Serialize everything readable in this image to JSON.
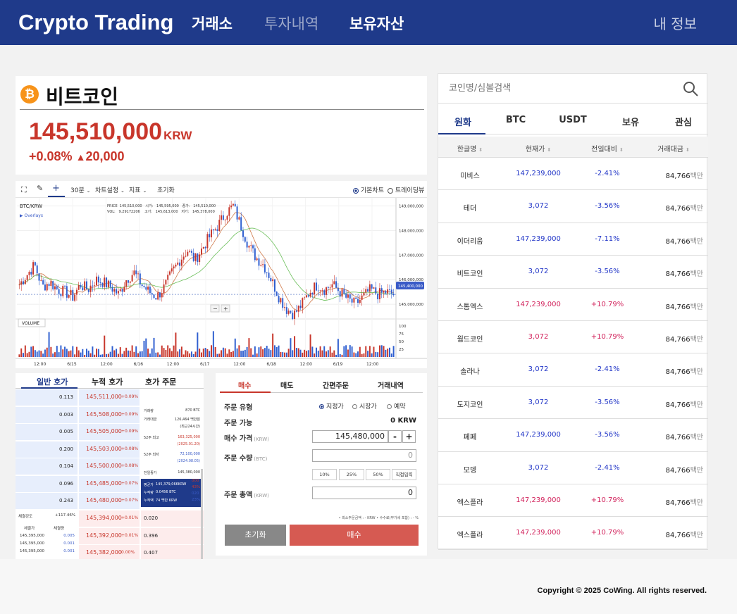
{
  "header": {
    "brand": "Crypto Trading",
    "nav": [
      "거래소",
      "투자내역",
      "보유자산"
    ],
    "my_info": "내 정보"
  },
  "coin": {
    "logo_symbol": "₿",
    "name": "비트코인",
    "price": "145,510,000",
    "unit": "KRW",
    "change_pct": "+0.08%",
    "change_arrow": "▲",
    "change_amount": "20,000"
  },
  "chart": {
    "toolbar": {
      "interval": "30분",
      "chart_settings": "차트설정",
      "indicators": "지표",
      "reset": "초기화",
      "basic_chart": "기본차트",
      "tradingview": "트레이딩뷰"
    },
    "symbol": "BTC/KRW",
    "overlays": "Overlays",
    "ohlc_line1": "PRICE  145,510,000   시가:   145,595,000   종가:   145,510,000",
    "ohlc_line2": "VOL:   9.29172206    고가:   145,613,000   저가:   145,378,000",
    "volume_label": "VOLUME",
    "current_price_tag": "145,400,000",
    "zoom_minus": "−",
    "zoom_plus": "+"
  },
  "chart_data": {
    "type": "candlestick",
    "price_axis": [
      "149,000,000",
      "148,000,000",
      "147,000,000",
      "146,000,000",
      "145,000,000"
    ],
    "volume_axis": [
      "100",
      "75",
      "50",
      "25"
    ],
    "x_labels": [
      "12:00",
      "6/15",
      "12:00",
      "6/16",
      "12:00",
      "6/17",
      "12:00",
      "6/18",
      "12:00",
      "6/19",
      "12:00"
    ],
    "ylim": [
      144400000,
      149100000
    ],
    "close_series": [
      145800000,
      146200000,
      146600000,
      145700000,
      145900000,
      145600000,
      145500000,
      145300000,
      145800000,
      145600000,
      146000000,
      145900000,
      145700000,
      145400000,
      146000000,
      146300000,
      145800000,
      145500000,
      145300000,
      145700000,
      146300000,
      146800000,
      147200000,
      146800000,
      147300000,
      147800000,
      148200000,
      148700000,
      149000000,
      148200000,
      147400000,
      146900000,
      146600000,
      146000000,
      145300000,
      144800000,
      144600000,
      145000000,
      145500000,
      145800000,
      145600000,
      145800000,
      145500000,
      145200000,
      145000000,
      145300000,
      145600000,
      145400000,
      145500000,
      145400000
    ]
  },
  "orderbook": {
    "tabs": [
      "일반 호가",
      "누적 호가",
      "호가 주문"
    ],
    "asks": [
      {
        "qty": "0.113",
        "price": "145,511,000",
        "pct": "+0.09%"
      },
      {
        "qty": "0.003",
        "price": "145,508,000",
        "pct": "+0.09%"
      },
      {
        "qty": "0.005",
        "price": "145,505,000",
        "pct": "+0.09%"
      },
      {
        "qty": "0.200",
        "price": "145,503,000",
        "pct": "+0.08%"
      },
      {
        "qty": "0.104",
        "price": "145,500,000",
        "pct": "+0.08%"
      },
      {
        "qty": "0.096",
        "price": "145,485,000",
        "pct": "+0.07%"
      },
      {
        "qty": "0.243",
        "price": "145,480,000",
        "pct": "+0.07%"
      }
    ],
    "bids": [
      {
        "qty": "0.020",
        "price": "145,394,000",
        "pct": "+0.01%"
      },
      {
        "qty": "0.396",
        "price": "145,392,000",
        "pct": "+0.01%"
      },
      {
        "qty": "0.407",
        "price": "145,382,000",
        "pct": "0.00%"
      }
    ],
    "info": [
      [
        "거래량",
        "870 BTC"
      ],
      [
        "거래대금",
        "126,464 백만원"
      ],
      [
        "",
        "(최근24시간)"
      ],
      [
        "52주 최고",
        "163,325,000"
      ],
      [
        "",
        "(2025.01.20)"
      ],
      [
        "52주 최저",
        "72,100,000"
      ],
      [
        "",
        "(2024.08.05)"
      ],
      [
        "전일종가",
        "145,380,000"
      ]
    ],
    "tooltip": [
      [
        "평균가",
        "145,379,066KRW"
      ],
      [
        "누적량",
        "0.0456 BTC"
      ],
      [
        "누적액",
        "74 백만 KRW"
      ]
    ],
    "tooltip_side": [
      "000",
      "43%",
      "020",
      "23%"
    ],
    "strength_label": "체결강도",
    "strength_value": "+117.46%",
    "trade_headers": [
      "체결가",
      "체결량"
    ],
    "trades": [
      {
        "price": "145,395,000",
        "qty": "0.005"
      },
      {
        "price": "145,395,000",
        "qty": "0.001"
      },
      {
        "price": "145,395,000",
        "qty": "0.001"
      }
    ]
  },
  "order_form": {
    "tabs": [
      "매수",
      "매도",
      "간편주문",
      "거래내역"
    ],
    "order_type_label": "주문 유형",
    "order_types": [
      "지정가",
      "시장가",
      "예약"
    ],
    "available_label": "주문 가능",
    "available_value": "0",
    "available_unit": "KRW",
    "price_label": "매수 가격",
    "price_sub": "(KRW)",
    "price_value": "145,480,000",
    "minus": "-",
    "plus": "+",
    "qty_label": "주문 수량",
    "qty_sub": "(BTC)",
    "qty_value": "0",
    "pct_buttons": [
      "10%",
      "25%",
      "50%",
      "직접입력"
    ],
    "total_label": "주문 총액",
    "total_sub": "(KRW)",
    "total_value": "0",
    "fee_note": "• 최소주문금액 : - KRW   • 수수료(부가세 포함) : - %",
    "reset_label": "초기화",
    "buy_label": "매수"
  },
  "market": {
    "search_placeholder": "코인명/심볼검색",
    "tabs": [
      "원화",
      "BTC",
      "USDT",
      "보유",
      "관심"
    ],
    "headers": [
      "한글명",
      "현재가",
      "전일대비",
      "거래대금"
    ],
    "rows": [
      {
        "name": "미비스",
        "price": "147,239,000",
        "change": "-2.41%",
        "volume": "84,766",
        "dir": "down"
      },
      {
        "name": "테더",
        "price": "3,072",
        "change": "-3.56%",
        "volume": "84,766",
        "dir": "down"
      },
      {
        "name": "이더리움",
        "price": "147,239,000",
        "change": "-7.11%",
        "volume": "84,766",
        "dir": "down"
      },
      {
        "name": "비트코인",
        "price": "3,072",
        "change": "-3.56%",
        "volume": "84,766",
        "dir": "down"
      },
      {
        "name": "스톰엑스",
        "price": "147,239,000",
        "change": "+10.79%",
        "volume": "84,766",
        "dir": "up"
      },
      {
        "name": "웜드코인",
        "price": "3,072",
        "change": "+10.79%",
        "volume": "84,766",
        "dir": "up"
      },
      {
        "name": "솔라나",
        "price": "3,072",
        "change": "-2.41%",
        "volume": "84,766",
        "dir": "down"
      },
      {
        "name": "도지코인",
        "price": "3,072",
        "change": "-3.56%",
        "volume": "84,766",
        "dir": "down"
      },
      {
        "name": "페페",
        "price": "147,239,000",
        "change": "-3.56%",
        "volume": "84,766",
        "dir": "down"
      },
      {
        "name": "모뎅",
        "price": "3,072",
        "change": "-2.41%",
        "volume": "84,766",
        "dir": "down"
      },
      {
        "name": "엑스플라",
        "price": "147,239,000",
        "change": "+10.79%",
        "volume": "84,766",
        "dir": "up"
      },
      {
        "name": "엑스플라",
        "price": "147,239,000",
        "change": "+10.79%",
        "volume": "84,766",
        "dir": "up"
      }
    ],
    "volume_unit": "백만",
    "up_color": "#d2245d",
    "down_color": "#2135c7"
  },
  "footer": {
    "copyright": "Copyright © 2025 CoWing. All rights reserved."
  }
}
